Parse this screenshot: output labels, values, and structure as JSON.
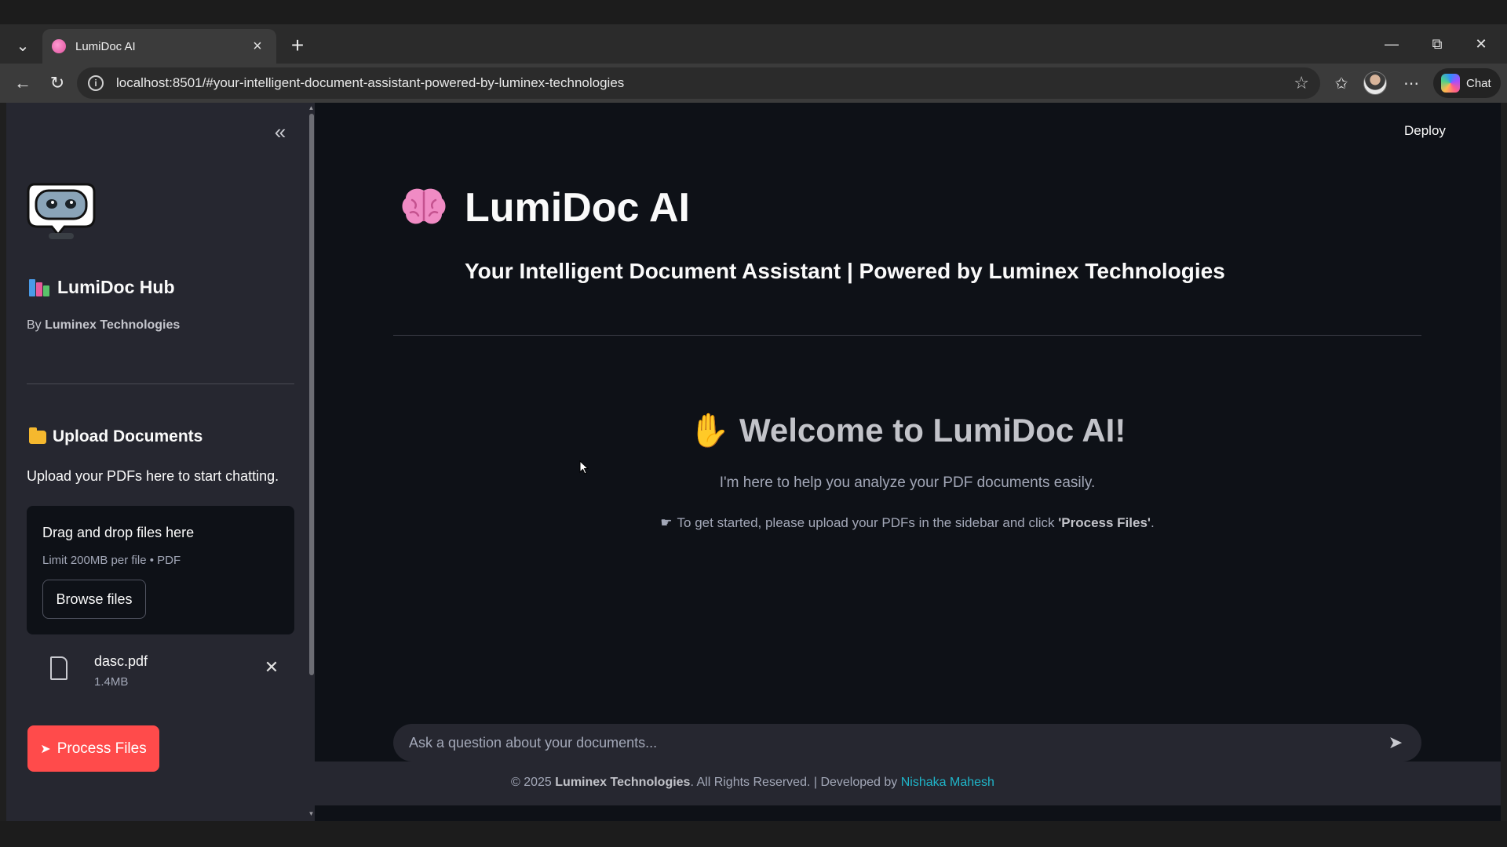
{
  "browser": {
    "tab_title": "LumiDoc AI",
    "url": "localhost:8501/#your-intelligent-document-assistant-powered-by-luminex-technologies",
    "chat_label": "Chat"
  },
  "sidebar": {
    "hub_title": "LumiDoc Hub",
    "by_prefix": "By ",
    "by_company": "Luminex Technologies",
    "upload_title": "Upload Documents",
    "upload_desc": "Upload your PDFs here to start chatting.",
    "dropzone_title": "Drag and drop files here",
    "dropzone_limit": "Limit 200MB per file • PDF",
    "browse_label": "Browse files",
    "file": {
      "name": "dasc.pdf",
      "size": "1.4MB"
    },
    "process_label": "Process Files"
  },
  "main": {
    "deploy_label": "Deploy",
    "title": "LumiDoc AI",
    "subtitle": "Your Intelligent Document Assistant | Powered by Luminex Technologies",
    "welcome": "Welcome to LumiDoc AI!",
    "welcome_desc": "I'm here to help you analyze your PDF documents easily.",
    "start_prefix": "To get started, please upload your PDFs in the sidebar and click ",
    "start_bold": "'Process Files'",
    "start_suffix": ".",
    "chat_placeholder": "Ask a question about your documents..."
  },
  "footer": {
    "prefix": "© 2025 ",
    "company": "Luminex Technologies",
    "middle": ". All Rights Reserved. | Developed by ",
    "developer": "Nishaka Mahesh"
  },
  "colors": {
    "primary_button": "#ff4b4b",
    "app_background": "#0e1117",
    "sidebar_background": "#262730",
    "link": "#1fb5c9"
  }
}
